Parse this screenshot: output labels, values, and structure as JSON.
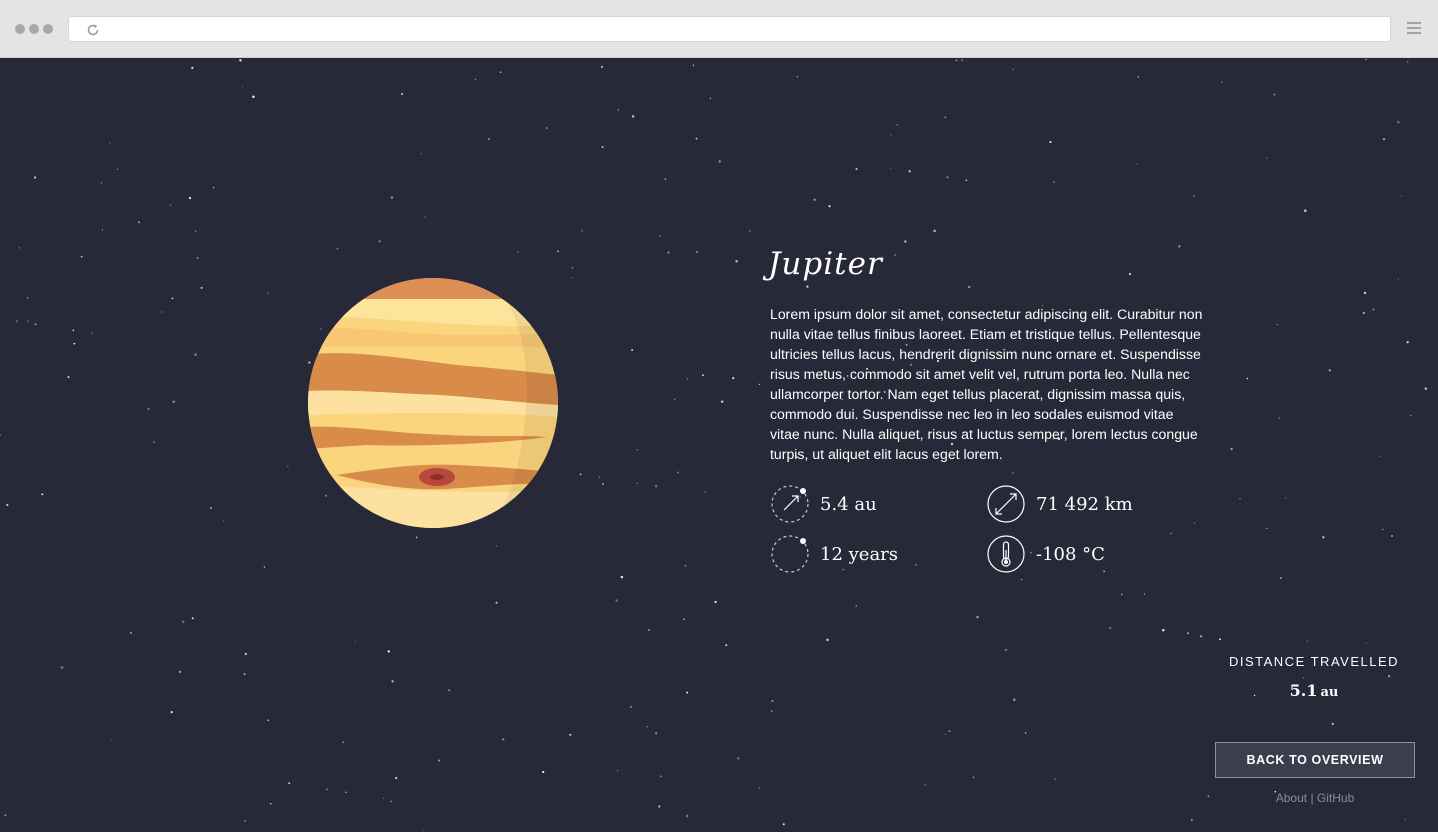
{
  "browser": {
    "url": "",
    "icons": {
      "reload": "reload-icon",
      "menu": "hamburger-menu-icon"
    }
  },
  "planet": {
    "name": "Jupiter",
    "description": "Lorem ipsum dolor sit amet, consectetur adipiscing elit. Curabitur non nulla vitae tellus finibus laoreet. Etiam et tristique tellus. Pellentesque ultricies tellus lacus, hendrerit dignissim nunc ornare et. Suspendisse risus metus, commodo sit amet velit vel, rutrum porta leo. Nulla nec ullamcorper tortor. Nam eget tellus placerat, dignissim massa quis, commodo dui. Suspendisse nec leo in leo sodales euismod vitae vitae nunc. Nulla aliquet, risus at luctus semper, lorem lectus congue turpis, ut aliquet elit lacus eget lorem.",
    "stats": {
      "distance": {
        "icon": "orbit-distance-icon",
        "value": "5.4 au"
      },
      "diameter": {
        "icon": "diameter-icon",
        "value": "71 492 km"
      },
      "orbital_period": {
        "icon": "orbit-period-icon",
        "value": "12 years"
      },
      "temperature": {
        "icon": "thermometer-icon",
        "value": "-108 °C"
      }
    }
  },
  "travel": {
    "label": "DISTANCE TRAVELLED",
    "value": "5.1",
    "unit": "au"
  },
  "actions": {
    "back_label": "BACK TO OVERVIEW"
  },
  "footer": {
    "about": "About",
    "separator": "|",
    "github": "GitHub"
  },
  "colors": {
    "background": "#272838",
    "chrome": "#e4e4e4",
    "text": "#ffffff",
    "planet_light": "#fde49a",
    "planet_mid": "#f9cf72",
    "planet_band": "#d98b4a",
    "red_spot": "#b8483c"
  }
}
